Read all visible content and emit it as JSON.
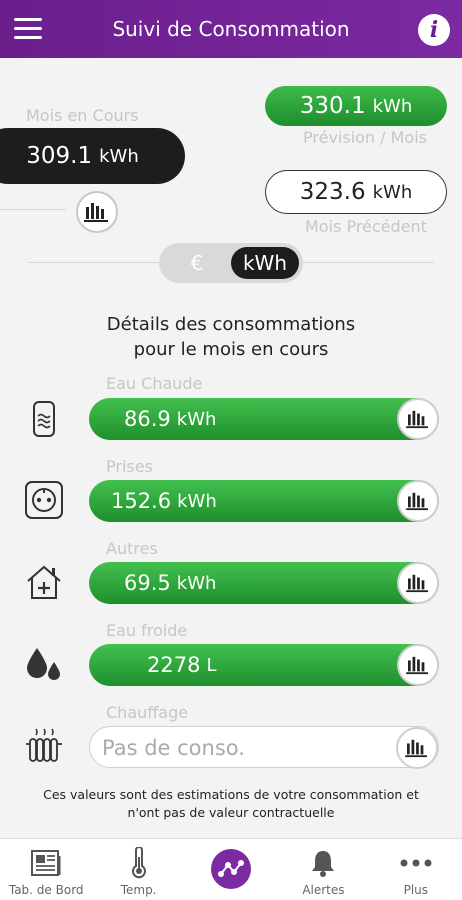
{
  "header": {
    "title": "Suivi de Consommation"
  },
  "summary": {
    "current_label": "Mois en Cours",
    "current_value": "309.1",
    "current_unit": "kWh",
    "forecast_value": "330.1",
    "forecast_unit": "kWh",
    "forecast_label": "Prévision / Mois",
    "previous_value": "323.6",
    "previous_unit": "kWh",
    "previous_label": "Mois Précédent"
  },
  "toggle": {
    "eur": "€",
    "kwh": "kWh",
    "selected": "kWh"
  },
  "details": {
    "title_line1": "Détails des consommations",
    "title_line2": "pour le mois en cours",
    "rows": [
      {
        "label": "Eau Chaude",
        "value": "86.9",
        "unit": "kWh",
        "icon": "water-heater-icon"
      },
      {
        "label": "Prises",
        "value": "152.6",
        "unit": "kWh",
        "icon": "power-outlet-icon"
      },
      {
        "label": "Autres",
        "value": "69.5",
        "unit": "kWh",
        "icon": "house-plus-icon"
      },
      {
        "label": "Eau froide",
        "value": "2278",
        "unit": "L",
        "icon": "water-drops-icon"
      },
      {
        "label": "Chauffage",
        "value": "Pas de conso.",
        "unit": "",
        "icon": "radiator-icon"
      }
    ]
  },
  "disclaimer": {
    "line1": "Ces valeurs sont des estimations de votre consommation et",
    "line2": "n'ont pas de valeur contractuelle"
  },
  "tabs": [
    {
      "label": "Tab. de Bord",
      "icon": "dashboard-icon"
    },
    {
      "label": "Temp.",
      "icon": "thermometer-icon"
    },
    {
      "label": "",
      "icon": "consumption-graph-icon"
    },
    {
      "label": "Alertes",
      "icon": "bell-icon"
    },
    {
      "label": "Plus",
      "icon": "more-dots-icon"
    }
  ],
  "colors": {
    "header": "#6a1e8c",
    "accent_green": "#2fa43d",
    "dark": "#1d1d1d"
  }
}
